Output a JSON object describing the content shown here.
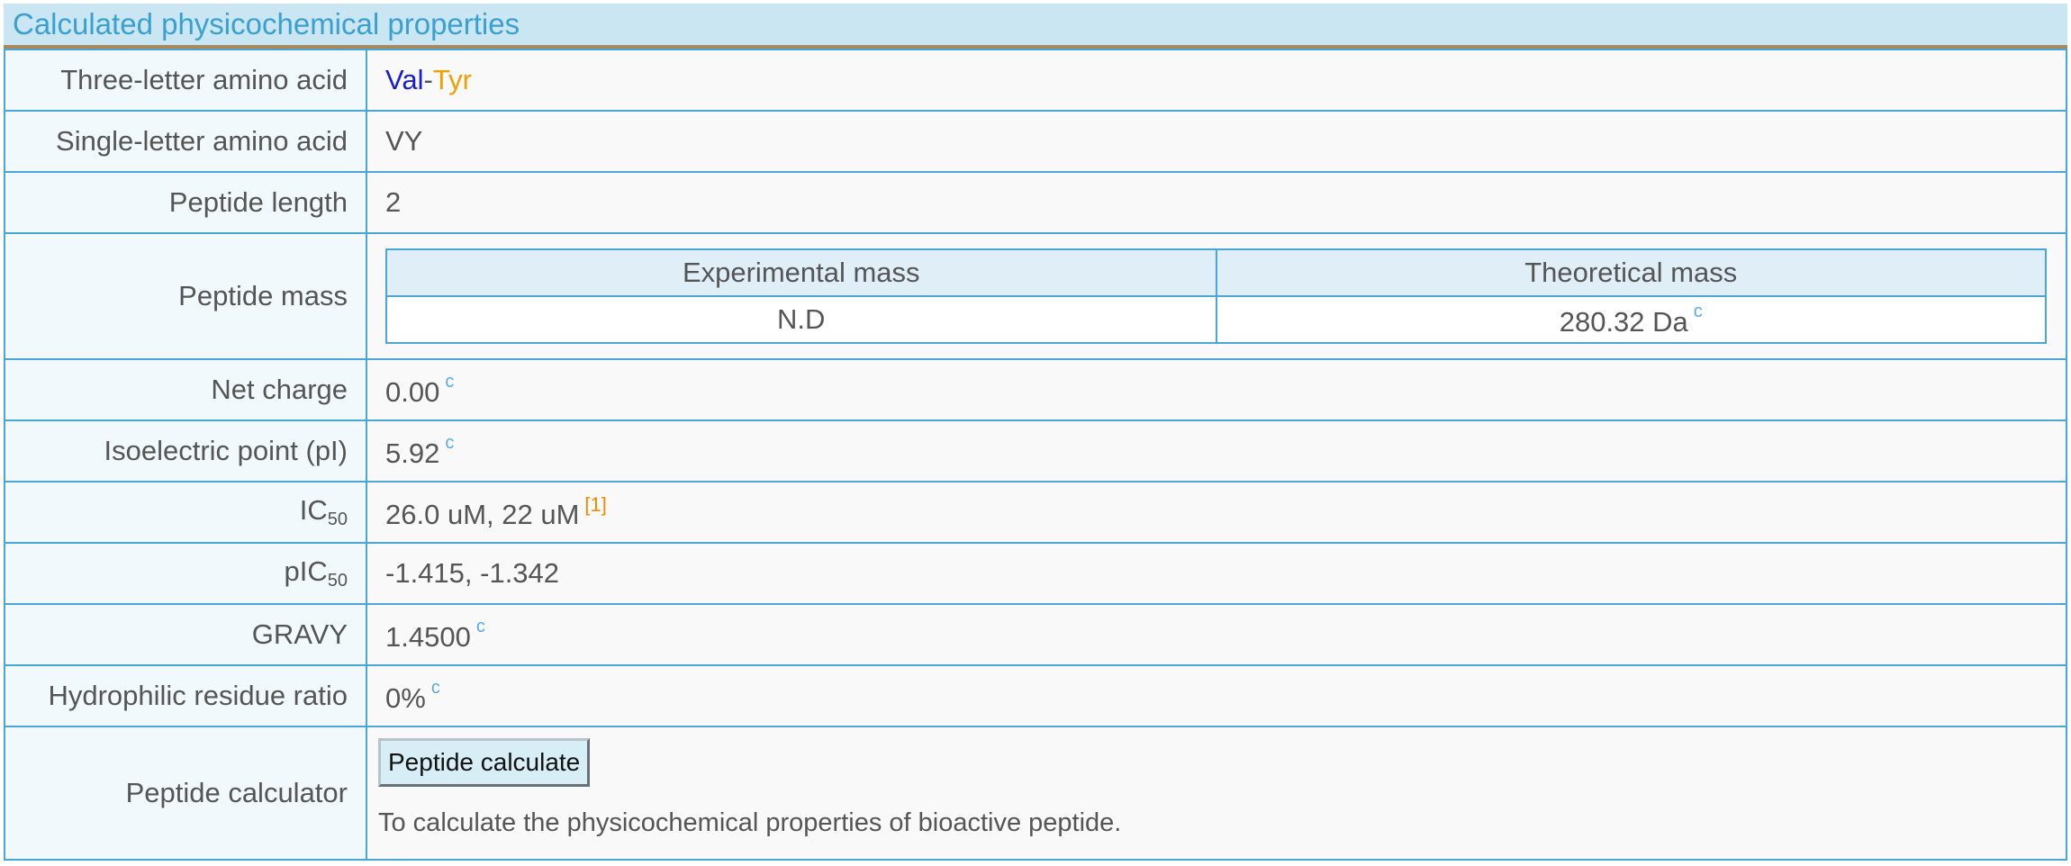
{
  "header": {
    "title": "Calculated physicochemical properties"
  },
  "rows": {
    "three_letter": {
      "label": "Three-letter amino acid",
      "residues": [
        {
          "text": "Val",
          "color": "#1a1ad6"
        },
        {
          "text": "Tyr",
          "color": "#f0a000"
        }
      ],
      "separator": "-"
    },
    "single_letter": {
      "label": "Single-letter amino acid",
      "value": "VY"
    },
    "length": {
      "label": "Peptide length",
      "value": "2"
    },
    "mass": {
      "label": "Peptide mass",
      "headers": [
        "Experimental mass",
        "Theoretical mass"
      ],
      "values": [
        "N.D",
        "280.32 Da"
      ],
      "theoretical_sup": "c"
    },
    "net_charge": {
      "label": "Net charge",
      "value": "0.00",
      "sup": "c"
    },
    "pi": {
      "label": "Isoelectric point (pI)",
      "value": "5.92",
      "sup": "c"
    },
    "ic50": {
      "label_main": "IC",
      "label_sub": "50",
      "value": "26.0 uM, 22 uM",
      "ref": "[1]"
    },
    "pic50": {
      "label_main": "pIC",
      "label_sub": "50",
      "value": "-1.415, -1.342"
    },
    "gravy": {
      "label": "GRAVY",
      "value": "1.4500",
      "sup": "c"
    },
    "hydrophilic": {
      "label": "Hydrophilic residue ratio",
      "value": "0%",
      "sup": "c"
    },
    "calculator": {
      "label": "Peptide calculator",
      "button": "Peptide calculate",
      "description": "To calculate the physicochemical properties of bioactive peptide."
    }
  },
  "colors": {
    "header_bg": "#c9e6f2",
    "header_text": "#3aa0d2",
    "border": "#4aa6d6",
    "sup_c": "#5aa9e6",
    "ref": "#f08a00"
  }
}
